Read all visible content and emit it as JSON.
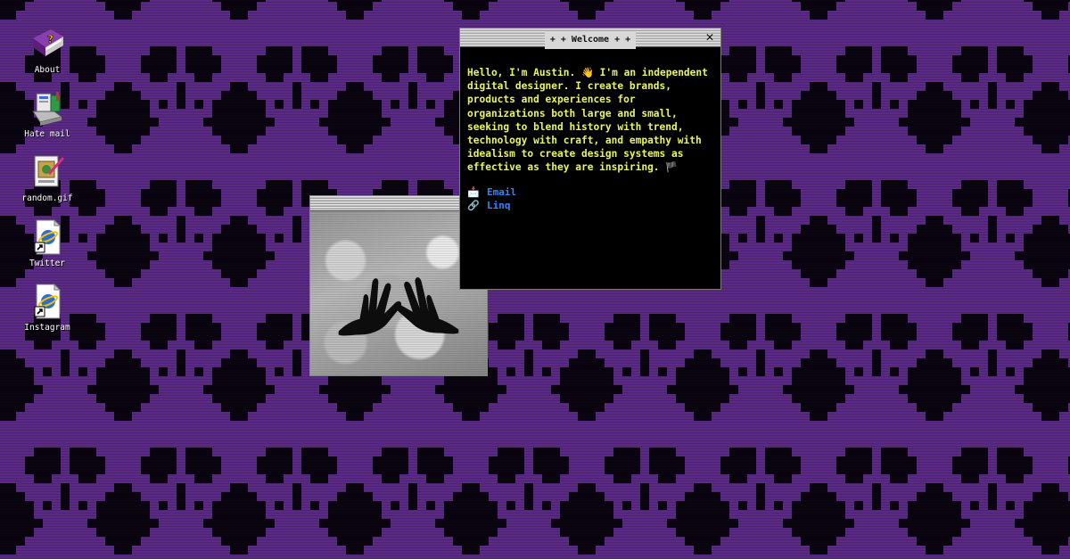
{
  "desktop": {
    "icons": [
      {
        "label": "About",
        "icon": "help-book-icon"
      },
      {
        "label": "Hate mail",
        "icon": "mailbox-icon"
      },
      {
        "label": "random.gif",
        "icon": "image-file-icon"
      },
      {
        "label": "Twitter",
        "icon": "shortcut-file-icon"
      },
      {
        "label": "Instagram",
        "icon": "shortcut-file-icon"
      }
    ],
    "wallpaper": {
      "pattern": "pixel-skulls",
      "color": "#5b2a86",
      "background": "#0a0510"
    }
  },
  "welcome_window": {
    "title": "+ + Welcome + +",
    "close_label": "✕",
    "intro": "Hello, I'm Austin. 👋 I'm an independent digital designer. I create brands, products and experiences for organizations both large and small, seeking to blend history with trend, technology with craft, and empathy with idealism to create design systems as effective as they are inspiring. 🏴",
    "links": [
      {
        "glyph": "📩",
        "label": "Email"
      },
      {
        "glyph": "🔗",
        "label": "Linq"
      }
    ],
    "text_color": "#e9f55c",
    "link_color": "#3b82f6"
  },
  "image_window": {
    "subject": "halftone image of two black hands"
  }
}
